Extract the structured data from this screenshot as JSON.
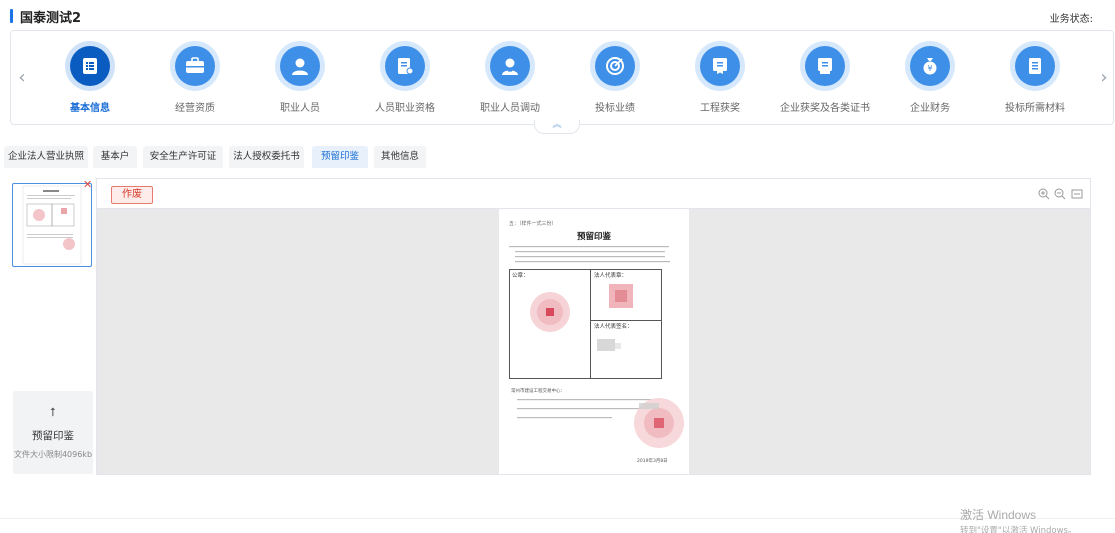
{
  "header": {
    "title": "国泰测试2",
    "status_label": "业务状态:"
  },
  "nav": {
    "items": [
      {
        "label": "基本信息",
        "icon": "list-document-icon",
        "active": true
      },
      {
        "label": "经营资质",
        "icon": "briefcase-icon",
        "active": false
      },
      {
        "label": "职业人员",
        "icon": "person-icon",
        "active": false
      },
      {
        "label": "人员职业资格",
        "icon": "certificate-document-icon",
        "active": false
      },
      {
        "label": "职业人员调动",
        "icon": "person-transfer-icon",
        "active": false
      },
      {
        "label": "投标业绩",
        "icon": "target-icon",
        "active": false
      },
      {
        "label": "工程获奖",
        "icon": "award-icon",
        "active": false
      },
      {
        "label": "企业获奖及各类证书",
        "icon": "award-certificate-icon",
        "active": false
      },
      {
        "label": "企业财务",
        "icon": "money-bag-icon",
        "active": false
      },
      {
        "label": "投标所需材料",
        "icon": "document-icon",
        "active": false
      }
    ]
  },
  "tabs": [
    {
      "label": "企业法人营业执照",
      "active": false
    },
    {
      "label": "基本户",
      "active": false
    },
    {
      "label": "安全生产许可证",
      "active": false
    },
    {
      "label": "法人授权委托书",
      "active": false
    },
    {
      "label": "预留印鉴",
      "active": true
    },
    {
      "label": "其他信息",
      "active": false
    }
  ],
  "viewer": {
    "void_button": "作废"
  },
  "upload": {
    "label": "预留印鉴",
    "hint": "文件大小限制4096kb"
  },
  "document": {
    "ref": "五：（样件一式三份）",
    "title": "预留印鉴",
    "box_labels": {
      "seal": "公章：",
      "legal_rep_seal": "法人代表章：",
      "legal_rep_sign": "法人代表签名："
    },
    "addressee": "常州市建设工程交易中心：",
    "date": "2019年3月8日"
  },
  "watermark": {
    "line1": "激活 Windows",
    "line2": "转到\"设置\"以激活 Windows。"
  },
  "colors": {
    "accent": "#1a6fd6",
    "icon_bg": "#3d8fe8",
    "active_icon_bg": "#0b5cc0",
    "danger": "#d63b2a"
  }
}
